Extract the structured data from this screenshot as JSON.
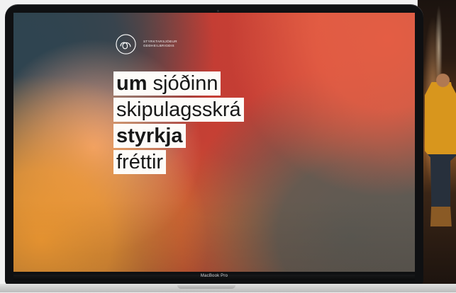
{
  "site": {
    "brand_line_1": "STYRKTARSJÓÐUR",
    "brand_line_2": "GEÐHEILBRIGÐIS",
    "menu": {
      "about_bold": "um",
      "about_rest": " sjóðinn",
      "charter": "skipulagsskrá",
      "grants": "styrkja",
      "news": "fréttir"
    }
  },
  "device": {
    "model": "MacBook Pro"
  },
  "icons": {
    "logo": "brand-loop-icon"
  },
  "colors": {
    "menu_background": "#fdfbf8",
    "menu_text": "#181818",
    "screen_dark": "#273c46",
    "screen_red": "#c53e34",
    "screen_orange": "#f19a33",
    "laptop_frame": "#0f1012"
  }
}
